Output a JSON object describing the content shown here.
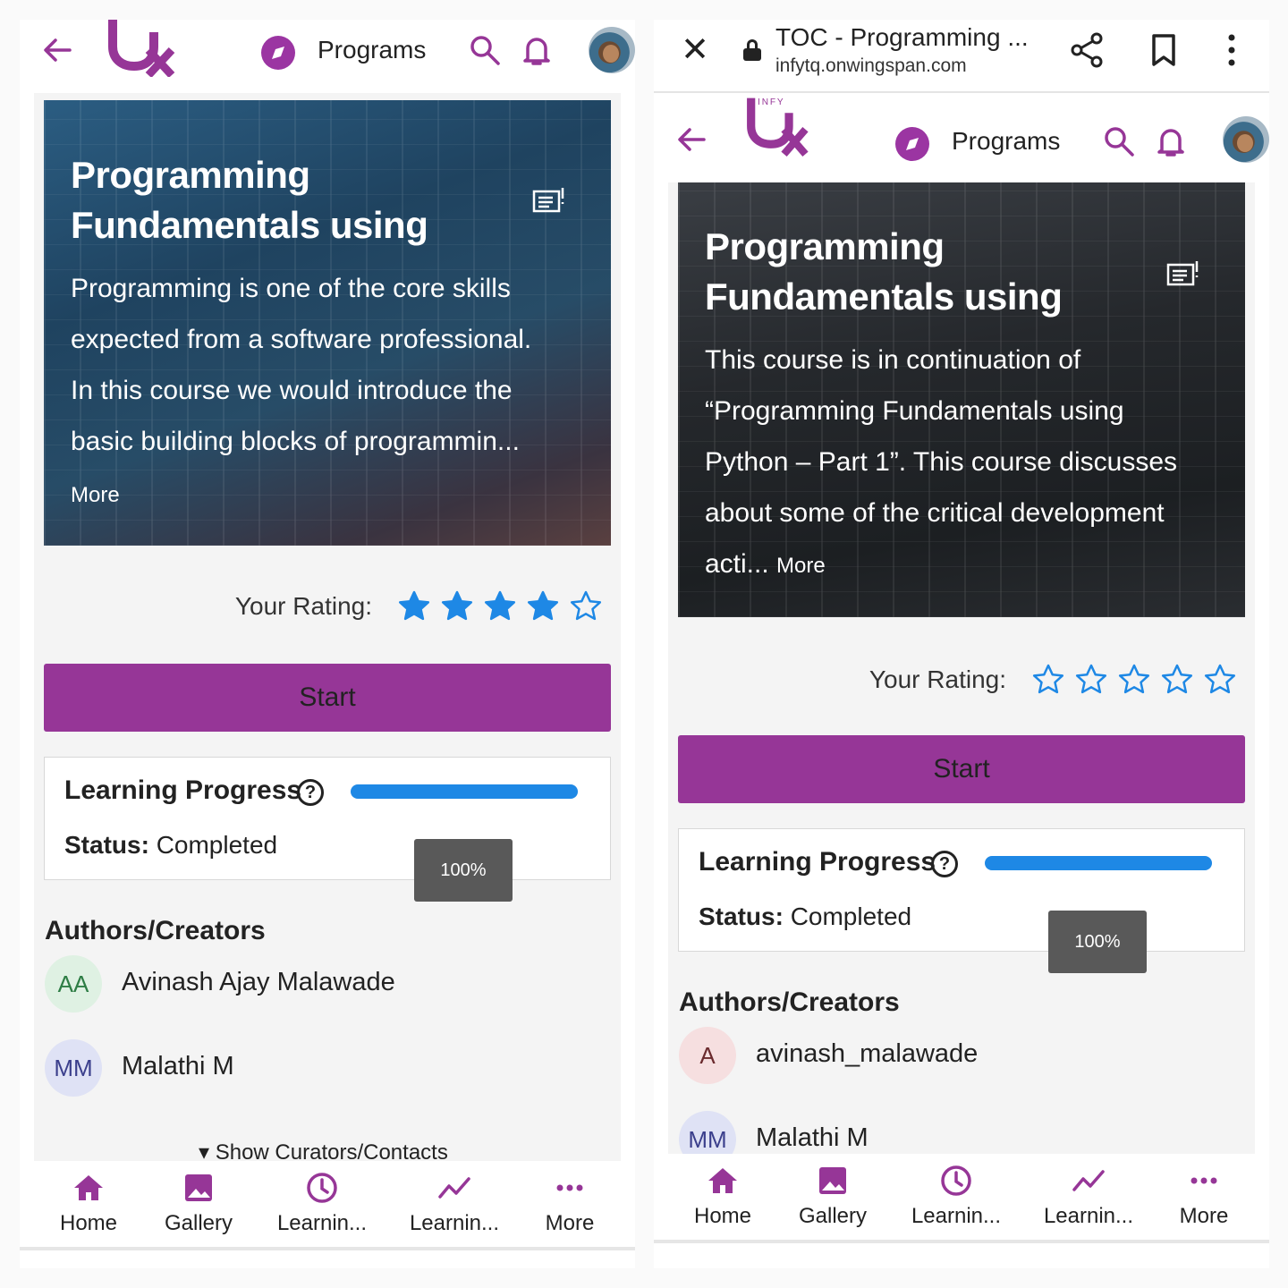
{
  "accent_color": "#963697",
  "progress_color": "#1e88e5",
  "star_color": "#1e88e5",
  "left": {
    "header": {
      "nav_label": "Programs"
    },
    "hero": {
      "title_line1": "Programming",
      "title_line2": "Fundamentals using",
      "description": [
        "Programming is one of the core skills",
        "expected from a software professional.",
        "In this course we would introduce the",
        "basic building blocks of programmin..."
      ],
      "more_label": "More"
    },
    "rating": {
      "label": "Your Rating:",
      "value": 4,
      "max": 5
    },
    "start_label": "Start",
    "progress": {
      "title": "Learning Progress",
      "help_glyph": "?",
      "status_label": "Status:",
      "status_value": "Completed",
      "percent_text": "100%",
      "percent": 100
    },
    "authors": {
      "title": "Authors/Creators",
      "items": [
        {
          "initials": "AA",
          "name": "Avinash Ajay Malawade",
          "avatar_bg": "#dff1e3",
          "avatar_fg": "#2e7d45"
        },
        {
          "initials": "MM",
          "name": "Malathi M",
          "avatar_bg": "#dfe2f5",
          "avatar_fg": "#3b3f8c"
        }
      ]
    },
    "show_curators": "Show Curators/Contacts",
    "bottom_nav": [
      {
        "label": "Home",
        "icon": "home-icon"
      },
      {
        "label": "Gallery",
        "icon": "gallery-icon"
      },
      {
        "label": "Learnin...",
        "icon": "clock-icon"
      },
      {
        "label": "Learnin...",
        "icon": "trend-icon"
      },
      {
        "label": "More",
        "icon": "more-dots-icon"
      }
    ]
  },
  "right": {
    "browser": {
      "title": "TOC - Programming ...",
      "url": "infytq.onwingspan.com"
    },
    "header": {
      "nav_label": "Programs",
      "logo_text": "INFY"
    },
    "hero": {
      "title_line1": "Programming",
      "title_line2": "Fundamentals using",
      "description": [
        "This course is in continuation of",
        "“Programming Fundamentals using",
        "Python – Part 1”. This course discusses",
        "about some of the critical development"
      ],
      "last_line": "acti...",
      "more_label": "More"
    },
    "rating": {
      "label": "Your Rating:",
      "value": 0,
      "max": 5
    },
    "start_label": "Start",
    "progress": {
      "title": "Learning Progress",
      "help_glyph": "?",
      "status_label": "Status:",
      "status_value": "Completed",
      "percent_text": "100%",
      "percent": 100
    },
    "authors": {
      "title": "Authors/Creators",
      "items": [
        {
          "initials": "A",
          "name": "avinash_malawade",
          "avatar_bg": "#f6dfe0",
          "avatar_fg": "#6b2b2e"
        },
        {
          "initials": "MM",
          "name": "Malathi M",
          "avatar_bg": "#dfe2f5",
          "avatar_fg": "#3b3f8c"
        }
      ]
    },
    "bottom_nav": [
      {
        "label": "Home",
        "icon": "home-icon"
      },
      {
        "label": "Gallery",
        "icon": "gallery-icon"
      },
      {
        "label": "Learnin...",
        "icon": "clock-icon"
      },
      {
        "label": "Learnin...",
        "icon": "trend-icon"
      },
      {
        "label": "More",
        "icon": "more-dots-icon"
      }
    ]
  }
}
